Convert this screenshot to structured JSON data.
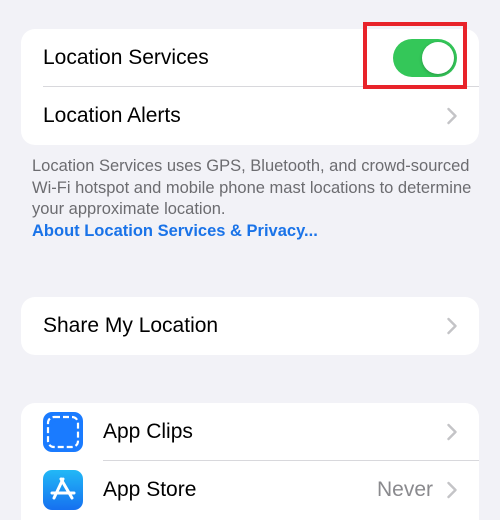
{
  "location_group": {
    "location_services_label": "Location Services",
    "location_services_enabled": true,
    "location_alerts_label": "Location Alerts"
  },
  "footer": {
    "description": "Location Services uses GPS, Bluetooth, and crowd-sourced Wi-Fi hotspot and mobile phone mast locations to determine your approximate location.",
    "link_label": "About Location Services & Privacy..."
  },
  "share_group": {
    "share_my_location_label": "Share My Location"
  },
  "apps_group": {
    "items": [
      {
        "label": "App Clips",
        "icon": "app-clips-icon",
        "value": ""
      },
      {
        "label": "App Store",
        "icon": "app-store-icon",
        "value": "Never"
      }
    ]
  },
  "colors": {
    "background": "#f2f2f7",
    "toggle_on": "#34c759",
    "link": "#1a73e8",
    "highlight": "#e8232a",
    "app_icon_blue": "#1a7bff"
  }
}
